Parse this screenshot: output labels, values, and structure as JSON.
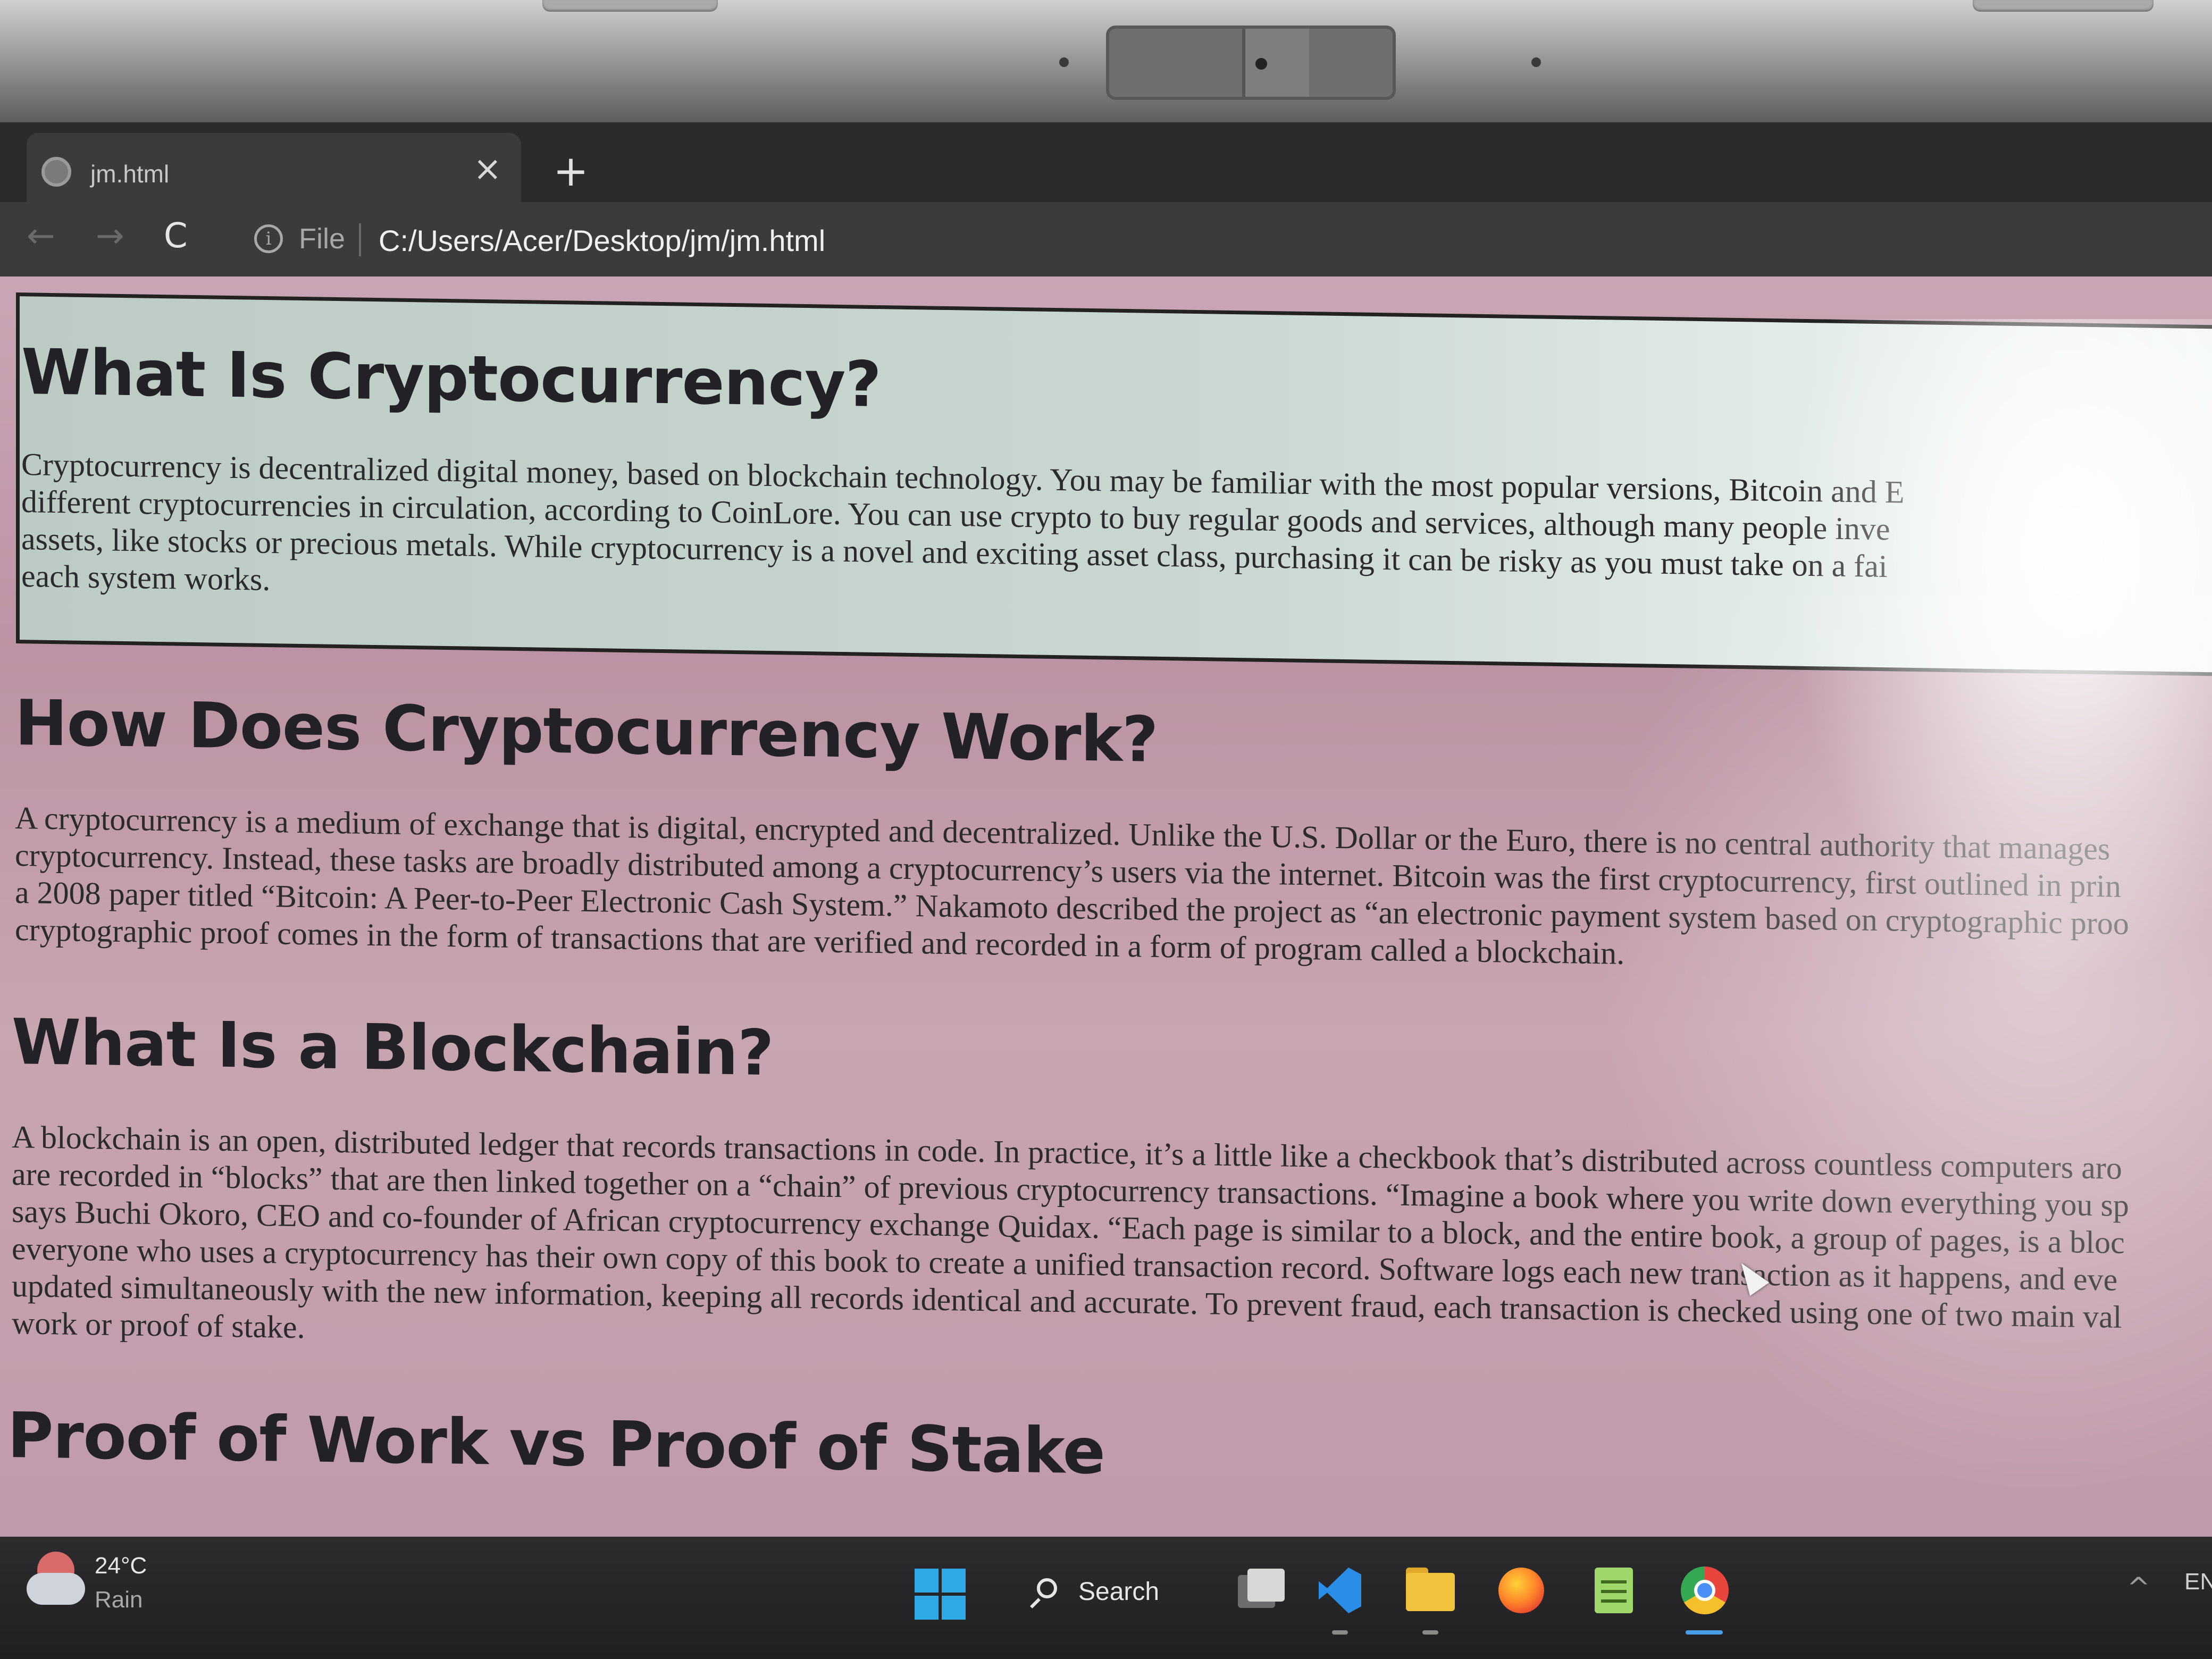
{
  "browser": {
    "tab_title": "jm.html",
    "close_glyph": "×",
    "new_tab_glyph": "+",
    "back_glyph": "←",
    "forward_glyph": "→",
    "reload_glyph": "C",
    "info_glyph": "i",
    "address_scheme": "File",
    "address_url": "C:/Users/Acer/Desktop/jm/jm.html"
  },
  "content": {
    "sections": [
      {
        "heading": "What Is Cryptocurrency?",
        "lines": [
          "Cryptocurrency is decentralized digital money, based on blockchain technology. You may be familiar with the most popular versions, Bitcoin and E",
          "different cryptocurrencies in circulation, according to CoinLore. You can use crypto to buy regular goods and services, although many people inve",
          "assets, like stocks or precious metals. While cryptocurrency is a novel and exciting asset class, purchasing it can be risky as you must take on a fai",
          "each system works."
        ]
      },
      {
        "heading": "How Does Cryptocurrency Work?",
        "lines": [
          "A cryptocurrency is a medium of exchange that is digital, encrypted and decentralized. Unlike the U.S. Dollar or the Euro, there is no central authority that manages",
          "cryptocurrency. Instead, these tasks are broadly distributed among a cryptocurrency’s users via the internet. Bitcoin was the first cryptocurrency, first outlined in prin",
          "a 2008 paper titled “Bitcoin: A Peer-to-Peer Electronic Cash System.” Nakamoto described the project as “an electronic payment system based on cryptographic proo",
          "cryptographic proof comes in the form of transactions that are verified and recorded in a form of program called a blockchain."
        ]
      },
      {
        "heading": "What Is a Blockchain?",
        "lines": [
          "A blockchain is an open, distributed ledger that records transactions in code. In practice, it’s a little like a checkbook that’s distributed across countless computers aro",
          "are recorded in “blocks” that are then linked together on a “chain” of previous cryptocurrency transactions. “Imagine a book where you write down everything you sp",
          "says Buchi Okoro, CEO and co-founder of African cryptocurrency exchange Quidax. “Each page is similar to a block, and the entire book, a group of pages, is a bloc",
          "everyone who uses a cryptocurrency has their own copy of this book to create a unified transaction record. Software logs each new transaction as it happens, and eve",
          "updated simultaneously with the new information, keeping all records identical and accurate. To prevent fraud, each transaction is checked using one of two main val",
          "work or proof of stake."
        ]
      },
      {
        "heading": "Proof of Work vs Proof of Stake",
        "lines": []
      }
    ]
  },
  "taskbar": {
    "weather_temp": "24°C",
    "weather_desc": "Rain",
    "search_label": "Search",
    "language": "EN",
    "tray_chevron": "^",
    "icons": [
      "windows-start-icon",
      "search-icon",
      "task-view-icon",
      "vscode-icon",
      "file-explorer-icon",
      "firefox-icon",
      "notepad-icon",
      "chrome-icon"
    ]
  }
}
